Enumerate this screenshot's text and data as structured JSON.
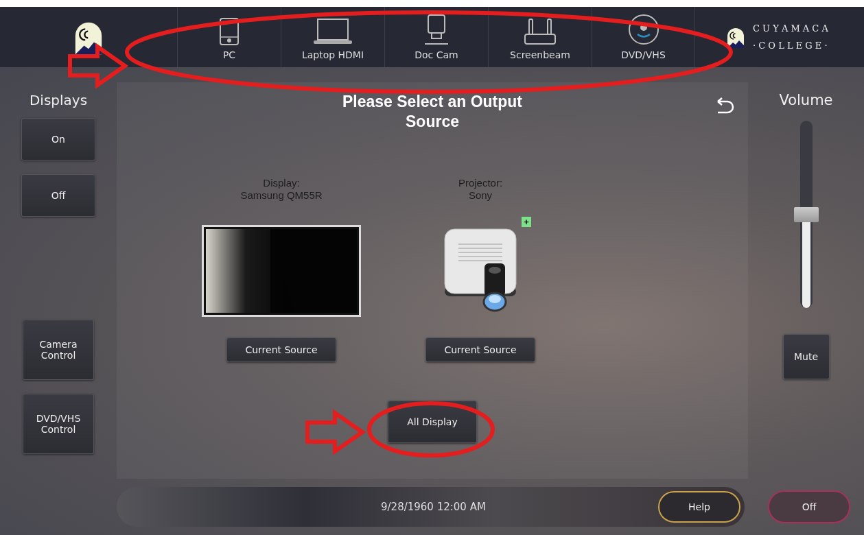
{
  "sources": [
    {
      "label": "PC",
      "kind": "pc",
      "selected": false
    },
    {
      "label": "Laptop HDMI",
      "kind": "laptop",
      "selected": false
    },
    {
      "label": "Doc Cam",
      "kind": "doccam",
      "selected": false
    },
    {
      "label": "Screenbeam",
      "kind": "router",
      "selected": false
    },
    {
      "label": "DVD/VHS",
      "kind": "dvd",
      "selected": false
    }
  ],
  "brand": {
    "line_1": "C U Y A M A C A",
    "line_2": "· C O L L E G E ·"
  },
  "displays": {
    "title": "Displays",
    "buttons": [
      "On",
      "Off"
    ],
    "controls": [
      "Camera Control",
      "DVD/VHS Control"
    ]
  },
  "main": {
    "title": "Please Select an Output Source",
    "outputs": [
      {
        "kind": "tv",
        "label": "Display:",
        "name": "Samsung QM55R",
        "button": "Current Source"
      },
      {
        "kind": "projector",
        "label": "Projector:",
        "name": "Sony",
        "badge": "+",
        "button": "Current Source"
      }
    ],
    "all_button": "All Display"
  },
  "volume": {
    "title": "Volume",
    "level": 0.5,
    "mute": "Mute"
  },
  "status_bar": {
    "datetime": "9/28/1960 12:00 AM",
    "help": "Help",
    "off": "Off"
  },
  "annotations": [
    {
      "kind": "arrow"
    },
    {
      "kind": "ellipse"
    },
    {
      "kind": "arrow"
    },
    {
      "kind": "ellipse"
    }
  ]
}
